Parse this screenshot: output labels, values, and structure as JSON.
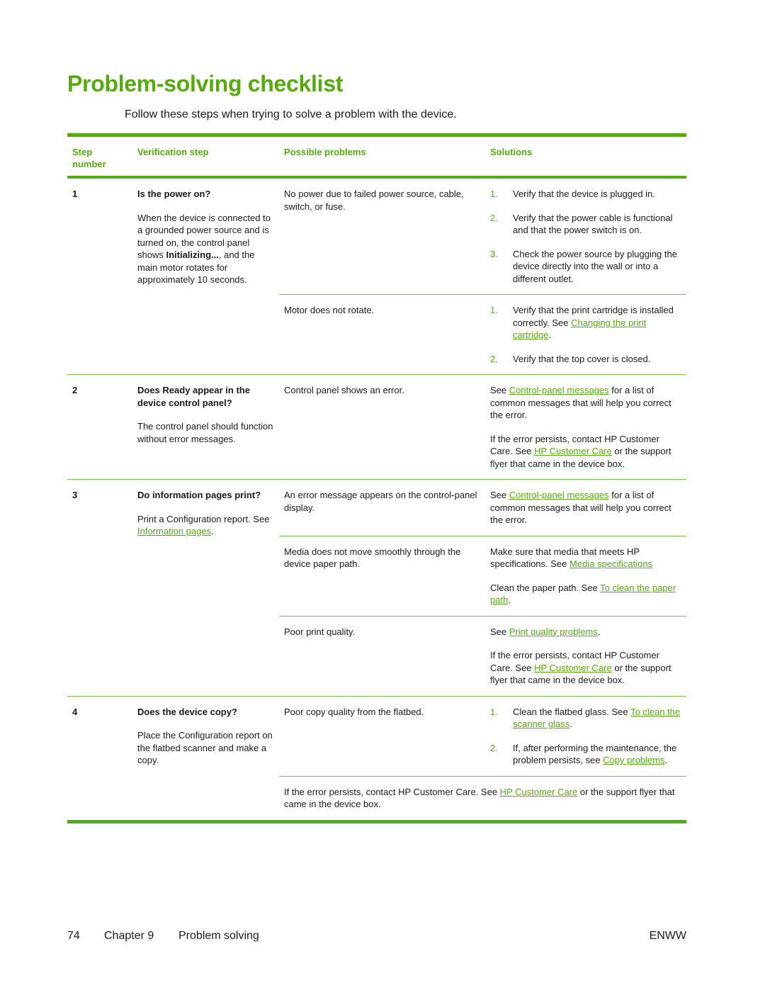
{
  "title": "Problem-solving checklist",
  "intro": "Follow these steps when trying to solve a problem with the device.",
  "colors": {
    "accent": "#55aa0f",
    "text": "#1a1a1a"
  },
  "table": {
    "headers": [
      "Step number",
      "Verification step",
      "Possible problems",
      "Solutions"
    ],
    "steps": [
      {
        "number": "1",
        "question": "Is the power on?",
        "desc_pre": "When the device is connected to a grounded power source and is turned on, the control panel shows ",
        "desc_bold": "Initializing...",
        "desc_post": ", and the main motor rotates for approximately 10 seconds.",
        "problems": [
          {
            "problem": "No power due to failed power source, cable, switch, or fuse.",
            "solutions": [
              {
                "n": "1.",
                "text": "Verify that the device is plugged in."
              },
              {
                "n": "2.",
                "text": "Verify that the power cable is functional and that the power switch is on."
              },
              {
                "n": "3.",
                "text": "Check the power source by plugging the device directly into the wall or into a different outlet."
              }
            ]
          },
          {
            "problem": "Motor does not rotate.",
            "solutions": [
              {
                "n": "1.",
                "pre": "Verify that the print cartridge is installed correctly. See ",
                "link": "Changing the print cartridge",
                "post": "."
              },
              {
                "n": "2.",
                "text": "Verify that the top cover is closed."
              }
            ]
          }
        ]
      },
      {
        "number": "2",
        "question": "Does Ready appear in the device control panel?",
        "desc": "The control panel should function without error messages.",
        "problems": [
          {
            "problem": "Control panel shows an error.",
            "paras": [
              {
                "pre": "See ",
                "link": "Control-panel messages",
                "post": " for a list of common messages that will help you correct the error."
              },
              {
                "pre": "If the error persists, contact HP Customer Care. See ",
                "link": "HP Customer Care",
                "post": " or the support flyer that came in the device box."
              }
            ]
          }
        ]
      },
      {
        "number": "3",
        "question": "Do information pages print?",
        "desc_pre": "Print a Configuration report. See ",
        "desc_link": "Information pages",
        "desc_post": ".",
        "problems": [
          {
            "problem": "An error message appears on the control-panel display.",
            "paras": [
              {
                "pre": "See ",
                "link": "Control-panel messages",
                "post": " for a list of common messages that will help you correct the error."
              }
            ]
          },
          {
            "problem": "Media does not move smoothly through the device paper path.",
            "paras": [
              {
                "pre": "Make sure that media that meets HP specifications. See ",
                "link": "Media specifications",
                "post": ""
              },
              {
                "pre": "Clean the paper path. See ",
                "link": "To clean the paper path",
                "post": "."
              }
            ]
          },
          {
            "problem": "Poor print quality.",
            "paras": [
              {
                "pre": "See ",
                "link": "Print quality problems",
                "post": "."
              },
              {
                "pre": "If the error persists, contact HP Customer Care. See ",
                "link": "HP Customer Care",
                "post": " or the support flyer that came in the device box."
              }
            ]
          }
        ]
      },
      {
        "number": "4",
        "question": "Does the device copy?",
        "desc": "Place the Configuration report on the flatbed scanner and make a copy.",
        "problems": [
          {
            "problem": "Poor copy quality from the flatbed.",
            "solutions": [
              {
                "n": "1.",
                "pre": "Clean the flatbed glass. See ",
                "link": "To clean the scanner glass",
                "post": "."
              },
              {
                "n": "2.",
                "pre": "If, after performing the maintenance, the problem persists, see ",
                "link": "Copy problems",
                "post": "."
              }
            ]
          }
        ],
        "span_note": {
          "pre": "If the error persists, contact HP Customer Care. See ",
          "link": "HP Customer Care",
          "post": " or the support flyer that came in the device box."
        }
      }
    ]
  },
  "footer": {
    "page": "74",
    "chapter": "Chapter 9",
    "section": "Problem solving",
    "locale": "ENWW"
  }
}
